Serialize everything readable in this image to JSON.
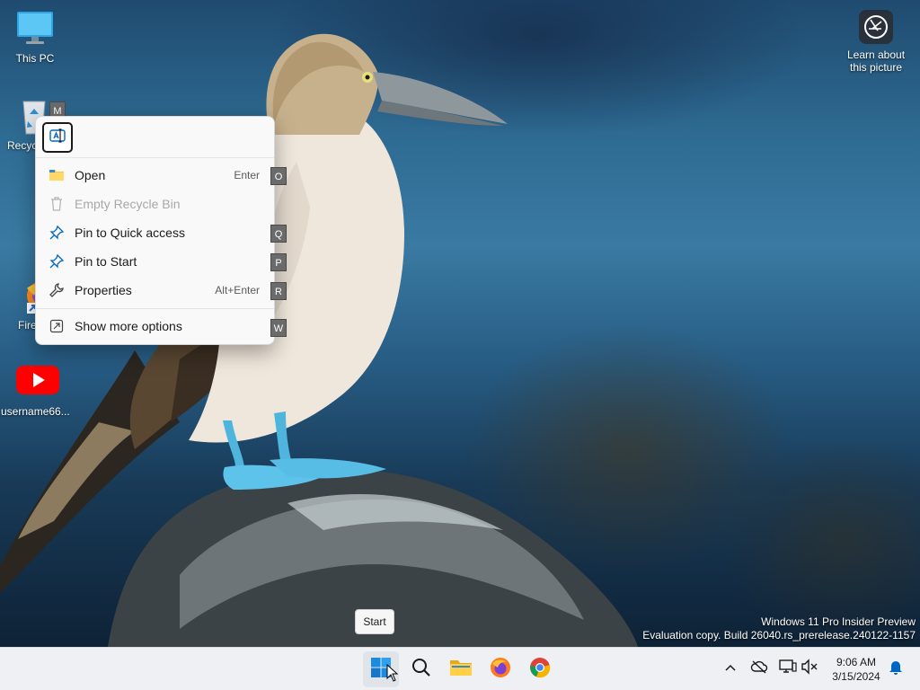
{
  "desktop": {
    "icons": [
      {
        "label": "This PC",
        "icon": "monitor-icon"
      },
      {
        "label": "Recyc",
        "icon": "recycle-bin-icon",
        "access_key": "M"
      },
      {
        "label": "Fire",
        "icon": "firefox-icon"
      },
      {
        "label": "username66...",
        "icon": "youtube-icon"
      }
    ],
    "learn_about": {
      "line1": "Learn about",
      "line2": "this picture",
      "icon": "camera-lens-icon"
    }
  },
  "context_menu": {
    "rename_icon": "rename-icon",
    "items": [
      {
        "label": "Open",
        "shortcut": "Enter",
        "access_key": "O",
        "icon": "folder-icon",
        "enabled": true
      },
      {
        "label": "Empty Recycle Bin",
        "shortcut": "",
        "access_key": "",
        "icon": "trash-icon",
        "enabled": false
      },
      {
        "label": "Pin to Quick access",
        "shortcut": "",
        "access_key": "Q",
        "icon": "pin-icon",
        "enabled": true
      },
      {
        "label": "Pin to Start",
        "shortcut": "",
        "access_key": "P",
        "icon": "pin-icon",
        "enabled": true
      },
      {
        "label": "Properties",
        "shortcut": "Alt+Enter",
        "access_key": "R",
        "icon": "wrench-icon",
        "enabled": true
      },
      {
        "label": "Show more options",
        "shortcut": "",
        "access_key": "W",
        "icon": "expand-icon",
        "enabled": true
      }
    ]
  },
  "watermark": {
    "line1": "Windows 11 Pro Insider Preview",
    "line2": "Evaluation copy. Build 26040.rs_prerelease.240122-1157"
  },
  "tooltip": {
    "text": "Start"
  },
  "taskbar": {
    "apps": [
      {
        "name": "Start",
        "icon": "windows-logo-icon"
      },
      {
        "name": "Search",
        "icon": "search-icon"
      },
      {
        "name": "File Explorer",
        "icon": "folder-icon"
      },
      {
        "name": "Firefox",
        "icon": "firefox-icon"
      },
      {
        "name": "Chrome",
        "icon": "chrome-icon"
      }
    ],
    "tray": {
      "icons": [
        "chevron-up-icon",
        "cloud-off-icon",
        "display-icon",
        "volume-muted-icon"
      ],
      "time": "9:06 AM",
      "date": "3/15/2024",
      "notification_icon": "bell-icon"
    }
  },
  "colors": {
    "accent": "#0067c0",
    "menu_bg": "#f9f9f9",
    "taskbar_bg": "#eef0f3",
    "youtube_red": "#ff0000"
  }
}
